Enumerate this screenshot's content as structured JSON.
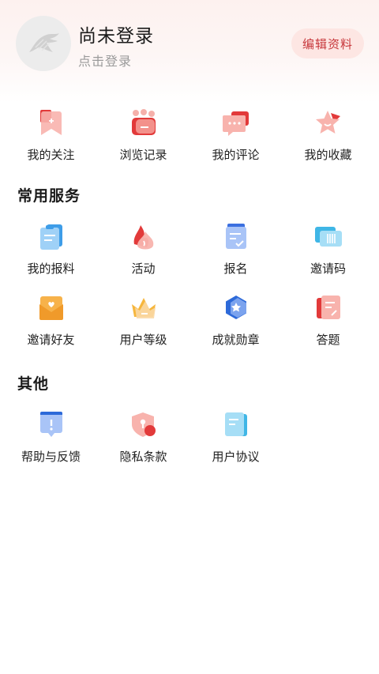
{
  "profile": {
    "username": "尚未登录",
    "login_hint": "点击登录",
    "edit_button": "编辑资料"
  },
  "quick_actions": [
    {
      "label": "我的关注",
      "icon": "bookmark-icon"
    },
    {
      "label": "浏览记录",
      "icon": "history-icon"
    },
    {
      "label": "我的评论",
      "icon": "comment-icon"
    },
    {
      "label": "我的收藏",
      "icon": "star-icon"
    }
  ],
  "services": {
    "title": "常用服务",
    "items": [
      {
        "label": "我的报料",
        "icon": "clipboard-icon"
      },
      {
        "label": "活动",
        "icon": "flame-icon"
      },
      {
        "label": "报名",
        "icon": "signup-icon"
      },
      {
        "label": "邀请码",
        "icon": "barcode-card-icon"
      },
      {
        "label": "邀请好友",
        "icon": "envelope-heart-icon"
      },
      {
        "label": "用户等级",
        "icon": "crown-icon"
      },
      {
        "label": "成就勋章",
        "icon": "medal-icon"
      },
      {
        "label": "答题",
        "icon": "quiz-icon"
      }
    ]
  },
  "other": {
    "title": "其他",
    "items": [
      {
        "label": "帮助与反馈",
        "icon": "help-feedback-icon"
      },
      {
        "label": "隐私条款",
        "icon": "privacy-shield-icon"
      },
      {
        "label": "用户协议",
        "icon": "agreement-icon"
      }
    ]
  }
}
